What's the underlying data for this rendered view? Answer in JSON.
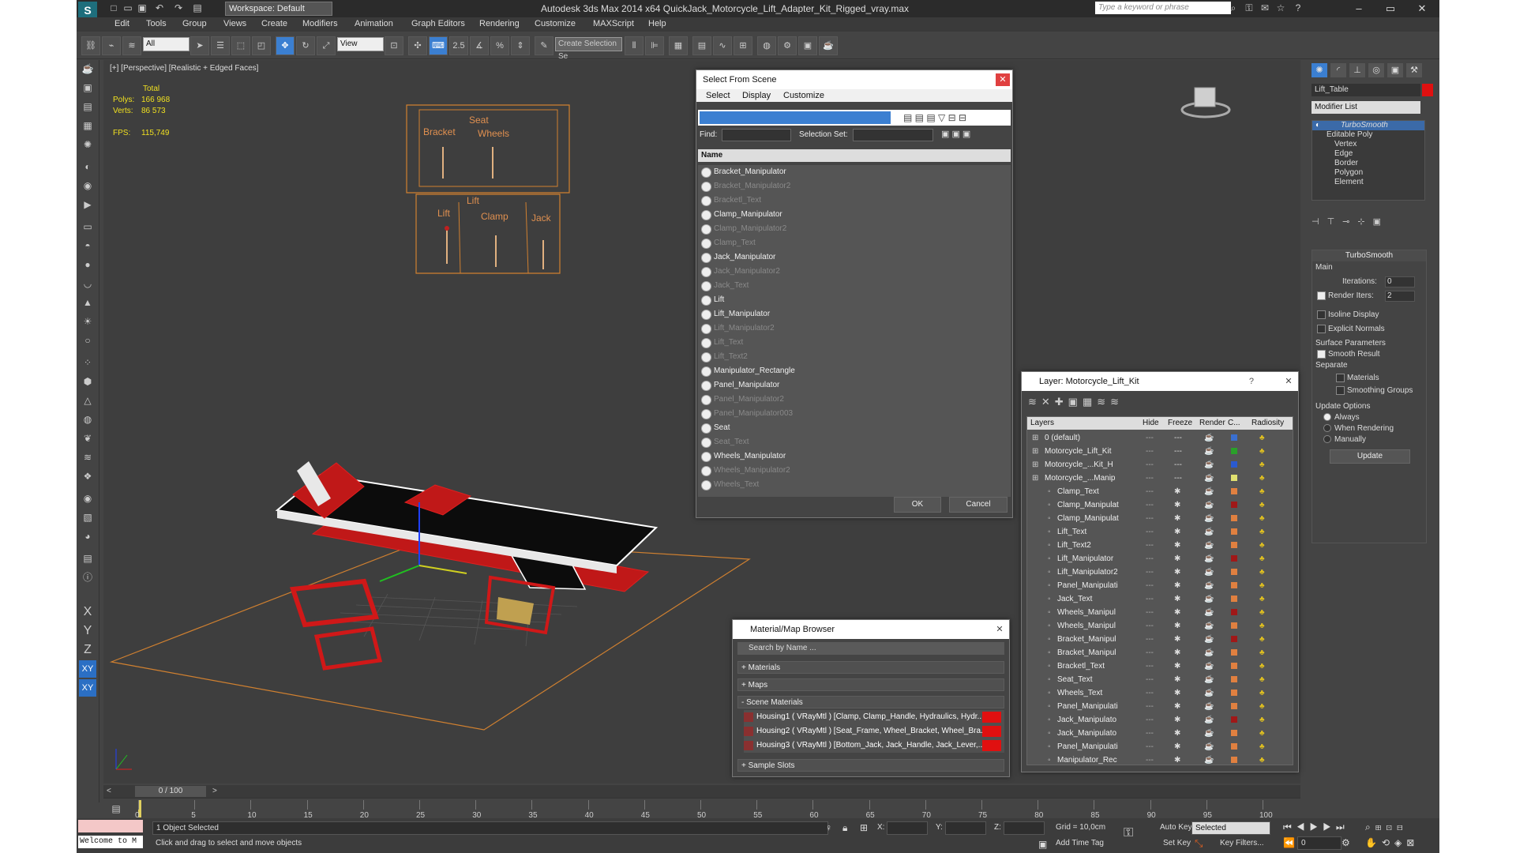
{
  "window": {
    "title": "Autodesk 3ds Max  2014 x64     QuickJack_Motorcycle_Lift_Adapter_Kit_Rigged_vray.max",
    "workspace": "Workspace: Default",
    "search_placeholder": "Type a keyword or phrase"
  },
  "menu": [
    "Edit",
    "Tools",
    "Group",
    "Views",
    "Create",
    "Modifiers",
    "Animation",
    "Graph Editors",
    "Rendering",
    "Customize",
    "MAXScript",
    "Help"
  ],
  "toolbar": {
    "filter": "All",
    "ref_coord": "View",
    "snap_value": "2.5",
    "selection_set": "Create Selection Se"
  },
  "viewport": {
    "label": "[+] [Perspective] [Realistic + Edged Faces]",
    "stats_header": "Total",
    "polys_label": "Polys:",
    "polys": "166 968",
    "verts_label": "Verts:",
    "verts": "86 573",
    "fps_label": "FPS:",
    "fps": "115,749",
    "panel_labels": [
      "Seat",
      "Bracket",
      "Wheels",
      "Lift",
      "Lift",
      "Clamp",
      "Jack"
    ]
  },
  "select_from_scene": {
    "title": "Select From Scene",
    "menu": [
      "Select",
      "Display",
      "Customize"
    ],
    "find_label": "Find:",
    "selection_set_label": "Selection Set:",
    "column": "Name",
    "items": [
      {
        "name": "Bracket_Manipulator",
        "dim": false
      },
      {
        "name": "Bracket_Manipulator2",
        "dim": true
      },
      {
        "name": "Bracketl_Text",
        "dim": true
      },
      {
        "name": "Clamp_Manipulator",
        "dim": false
      },
      {
        "name": "Clamp_Manipulator2",
        "dim": true
      },
      {
        "name": "Clamp_Text",
        "dim": true
      },
      {
        "name": "Jack_Manipulator",
        "dim": false
      },
      {
        "name": "Jack_Manipulator2",
        "dim": true
      },
      {
        "name": "Jack_Text",
        "dim": true
      },
      {
        "name": "Lift",
        "dim": false
      },
      {
        "name": "Lift_Manipulator",
        "dim": false
      },
      {
        "name": "Lift_Manipulator2",
        "dim": true
      },
      {
        "name": "Lift_Text",
        "dim": true
      },
      {
        "name": "Lift_Text2",
        "dim": true
      },
      {
        "name": "Manipulator_Rectangle",
        "dim": false
      },
      {
        "name": "Panel_Manipulator",
        "dim": false
      },
      {
        "name": "Panel_Manipulator2",
        "dim": true
      },
      {
        "name": "Panel_Manipulator003",
        "dim": true
      },
      {
        "name": "Seat",
        "dim": false
      },
      {
        "name": "Seat_Text",
        "dim": true
      },
      {
        "name": "Wheels_Manipulator",
        "dim": false
      },
      {
        "name": "Wheels_Manipulator2",
        "dim": true
      },
      {
        "name": "Wheels_Text",
        "dim": true
      }
    ],
    "ok": "OK",
    "cancel": "Cancel"
  },
  "layer_dialog": {
    "title": "Layer: Motorcycle_Lift_Kit",
    "help": "?",
    "columns": [
      "Layers",
      "Hide",
      "Freeze",
      "Render",
      "C...",
      "Radiosity"
    ],
    "rows": [
      {
        "name": "0 (default)",
        "indent": 0,
        "color": "#3a6fd0"
      },
      {
        "name": "Motorcycle_Lift_Kit",
        "indent": 0,
        "color": "#2aa02a"
      },
      {
        "name": "Motorcycle_...Kit_H",
        "indent": 0,
        "color": "#2a5ad0"
      },
      {
        "name": "Motorcycle_...Manip",
        "indent": 0,
        "color": "#e0e070"
      },
      {
        "name": "Clamp_Text",
        "indent": 1,
        "color": "#e08040"
      },
      {
        "name": "Clamp_Manipulat",
        "indent": 1,
        "color": "#a01818"
      },
      {
        "name": "Clamp_Manipulat",
        "indent": 1,
        "color": "#e08040"
      },
      {
        "name": "Lift_Text",
        "indent": 1,
        "color": "#e08040"
      },
      {
        "name": "Lift_Text2",
        "indent": 1,
        "color": "#e08040"
      },
      {
        "name": "Lift_Manipulator",
        "indent": 1,
        "color": "#a01818"
      },
      {
        "name": "Lift_Manipulator2",
        "indent": 1,
        "color": "#e08040"
      },
      {
        "name": "Panel_Manipulati",
        "indent": 1,
        "color": "#e08040"
      },
      {
        "name": "Jack_Text",
        "indent": 1,
        "color": "#e08040"
      },
      {
        "name": "Wheels_Manipul",
        "indent": 1,
        "color": "#a01818"
      },
      {
        "name": "Wheels_Manipul",
        "indent": 1,
        "color": "#e08040"
      },
      {
        "name": "Bracket_Manipul",
        "indent": 1,
        "color": "#a01818"
      },
      {
        "name": "Bracket_Manipul",
        "indent": 1,
        "color": "#e08040"
      },
      {
        "name": "Bracketl_Text",
        "indent": 1,
        "color": "#e08040"
      },
      {
        "name": "Seat_Text",
        "indent": 1,
        "color": "#e08040"
      },
      {
        "name": "Wheels_Text",
        "indent": 1,
        "color": "#e08040"
      },
      {
        "name": "Panel_Manipulati",
        "indent": 1,
        "color": "#e08040"
      },
      {
        "name": "Jack_Manipulato",
        "indent": 1,
        "color": "#a01818"
      },
      {
        "name": "Jack_Manipulato",
        "indent": 1,
        "color": "#e08040"
      },
      {
        "name": "Panel_Manipulati",
        "indent": 1,
        "color": "#e08040"
      },
      {
        "name": "Manipulator_Rec",
        "indent": 1,
        "color": "#e08040"
      }
    ]
  },
  "material_browser": {
    "title": "Material/Map Browser",
    "search_placeholder": "Search by Name ...",
    "sections": [
      "+ Materials",
      "+ Maps",
      "- Scene Materials"
    ],
    "materials": [
      "Housing1  ( VRayMtl ) [Clamp, Clamp_Handle, Hydraulics, Hydr...",
      "Housing2  ( VRayMtl ) [Seat_Frame, Wheel_Bracket, Wheel_Bra...",
      "Housing3  ( VRayMtl ) [Bottom_Jack, Jack_Handle, Jack_Lever,..."
    ],
    "sample_slots": "+ Sample Slots"
  },
  "command_panel": {
    "object_name": "Lift_Table",
    "modifier_list": "Modifier List",
    "stack": [
      "TurboSmooth",
      "Editable Poly",
      "Vertex",
      "Edge",
      "Border",
      "Polygon",
      "Element"
    ],
    "turbosmooth_title": "TurboSmooth",
    "main_label": "Main",
    "iterations_label": "Iterations:",
    "iterations": "0",
    "render_iters_label": "Render Iters:",
    "render_iters": "2",
    "isoline": "Isoline Display",
    "explicit_normals": "Explicit Normals",
    "surface_params": "Surface Parameters",
    "smooth_result": "Smooth Result",
    "separate": "Separate",
    "materials": "Materials",
    "smoothing_groups": "Smoothing Groups",
    "update_options": "Update Options",
    "always": "Always",
    "when_rendering": "When Rendering",
    "manually": "Manually",
    "update_btn": "Update"
  },
  "timeline": {
    "frame": "0 / 100",
    "ticks": [
      "0",
      "5",
      "10",
      "15",
      "20",
      "25",
      "30",
      "35",
      "40",
      "45",
      "50",
      "55",
      "60",
      "65",
      "70",
      "75",
      "80",
      "85",
      "90",
      "95",
      "100"
    ]
  },
  "status": {
    "selected": "1 Object Selected",
    "prompt": "Click and drag to select and move objects",
    "welcome": "Welcome to M",
    "x_label": "X:",
    "y_label": "Y:",
    "z_label": "Z:",
    "grid": "Grid = 10,0cm",
    "add_time_tag": "Add Time Tag",
    "auto_key": "Auto Key",
    "set_key": "Set Key",
    "selected_dropdown": "Selected",
    "key_filters": "Key Filters...",
    "current_frame": "0"
  }
}
